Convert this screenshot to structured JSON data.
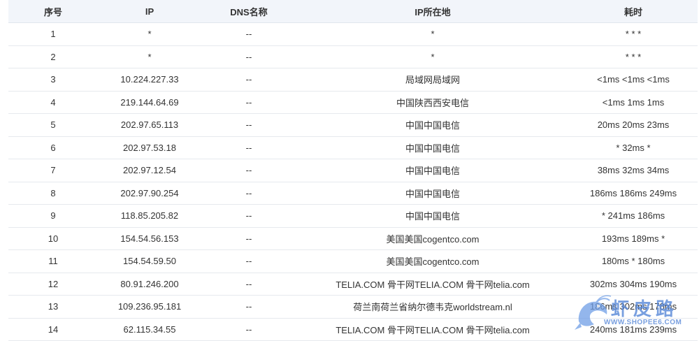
{
  "headers": {
    "no": "序号",
    "ip": "IP",
    "dns": "DNS名称",
    "location": "IP所在地",
    "time": "耗时"
  },
  "rows": [
    {
      "no": "1",
      "ip": "*",
      "dns": "--",
      "location": "*",
      "time": "* * *"
    },
    {
      "no": "2",
      "ip": "*",
      "dns": "--",
      "location": "*",
      "time": "* * *"
    },
    {
      "no": "3",
      "ip": "10.224.227.33",
      "dns": "--",
      "location": "局域网局域网",
      "time": "<1ms <1ms <1ms"
    },
    {
      "no": "4",
      "ip": "219.144.64.69",
      "dns": "--",
      "location": "中国陕西西安电信",
      "time": "<1ms 1ms 1ms"
    },
    {
      "no": "5",
      "ip": "202.97.65.113",
      "dns": "--",
      "location": "中国中国电信",
      "time": "20ms 20ms 23ms"
    },
    {
      "no": "6",
      "ip": "202.97.53.18",
      "dns": "--",
      "location": "中国中国电信",
      "time": "* 32ms *"
    },
    {
      "no": "7",
      "ip": "202.97.12.54",
      "dns": "--",
      "location": "中国中国电信",
      "time": "38ms 32ms 34ms"
    },
    {
      "no": "8",
      "ip": "202.97.90.254",
      "dns": "--",
      "location": "中国中国电信",
      "time": "186ms 186ms 249ms"
    },
    {
      "no": "9",
      "ip": "118.85.205.82",
      "dns": "--",
      "location": "中国中国电信",
      "time": "* 241ms 186ms"
    },
    {
      "no": "10",
      "ip": "154.54.56.153",
      "dns": "--",
      "location": "美国美国cogentco.com",
      "time": "193ms 189ms *"
    },
    {
      "no": "11",
      "ip": "154.54.59.50",
      "dns": "--",
      "location": "美国美国cogentco.com",
      "time": "180ms * 180ms"
    },
    {
      "no": "12",
      "ip": "80.91.246.200",
      "dns": "--",
      "location": "TELIA.COM 骨干网TELIA.COM 骨干网telia.com",
      "time": "302ms 304ms 190ms"
    },
    {
      "no": "13",
      "ip": "109.236.95.181",
      "dns": "--",
      "location": "荷兰南荷兰省纳尔德韦克worldstream.nl",
      "time": "186ms 302ms 178ms"
    },
    {
      "no": "14",
      "ip": "62.115.34.55",
      "dns": "--",
      "location": "TELIA.COM 骨干网TELIA.COM 骨干网telia.com",
      "time": "240ms 181ms 239ms"
    }
  ],
  "watermark": {
    "title": "虾皮路",
    "url": "WWW.SHOPEE6.COM",
    "icon": "shrimp-logo-icon",
    "color": "#5b8ad8"
  },
  "colors": {
    "header_bg": "#f2f5fa",
    "row_border": "#e6e9ee",
    "text": "#333333"
  }
}
